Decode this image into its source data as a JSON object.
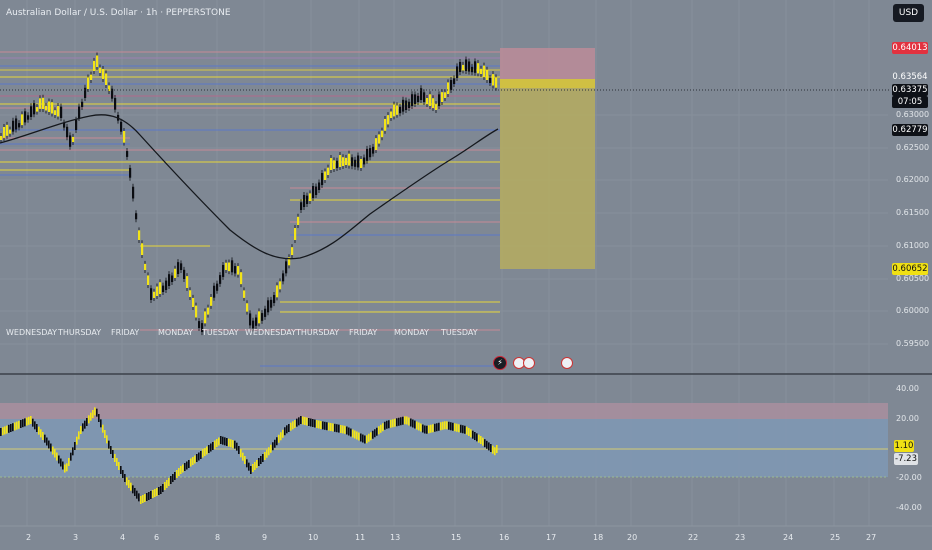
{
  "header": {
    "title": "Australian Dollar / U.S. Dollar · 1h · PEPPERSTONE",
    "currency_button": "USD"
  },
  "price_tags": {
    "target": "0.64013",
    "price_1": "0.63564",
    "current": "0.63375",
    "countdown": "07:05",
    "ma": "0.62779",
    "stop": "0.60652"
  },
  "price_axis": [
    "0.63000",
    "0.62500",
    "0.62000",
    "0.61500",
    "0.61000",
    "0.60500",
    "0.60000",
    "0.59500"
  ],
  "day_labels": [
    "WEDNESDAY",
    "THURSDAY",
    "FRIDAY",
    "MONDAY",
    "TUESDAY",
    "WEDNESDAY",
    "THURSDAY",
    "FRIDAY",
    "MONDAY",
    "TUESDAY"
  ],
  "oscillator": {
    "axis": [
      "40.00",
      "20.00",
      "-20.00",
      "-40.00"
    ],
    "value_1": "1.10",
    "value_2": "-7.23"
  },
  "time_axis": [
    "2",
    "3",
    "4",
    "6",
    "8",
    "9",
    "10",
    "11",
    "13",
    "15",
    "16",
    "17",
    "18",
    "20",
    "22",
    "23",
    "24",
    "25",
    "27"
  ],
  "colors": {
    "background": "#7f8894",
    "candle_up": "#f2e418",
    "candle_down": "#0b0d12",
    "target_zone": "#b98c98",
    "stop_zone": "#b6ad5f",
    "tag_red": "#e2323f",
    "tag_yellow": "#f0e014",
    "tag_dark": "#0e1117"
  },
  "events": [
    "flash-icon",
    "us-flag-icon",
    "us-flag-icon",
    "us-flag-icon"
  ]
}
